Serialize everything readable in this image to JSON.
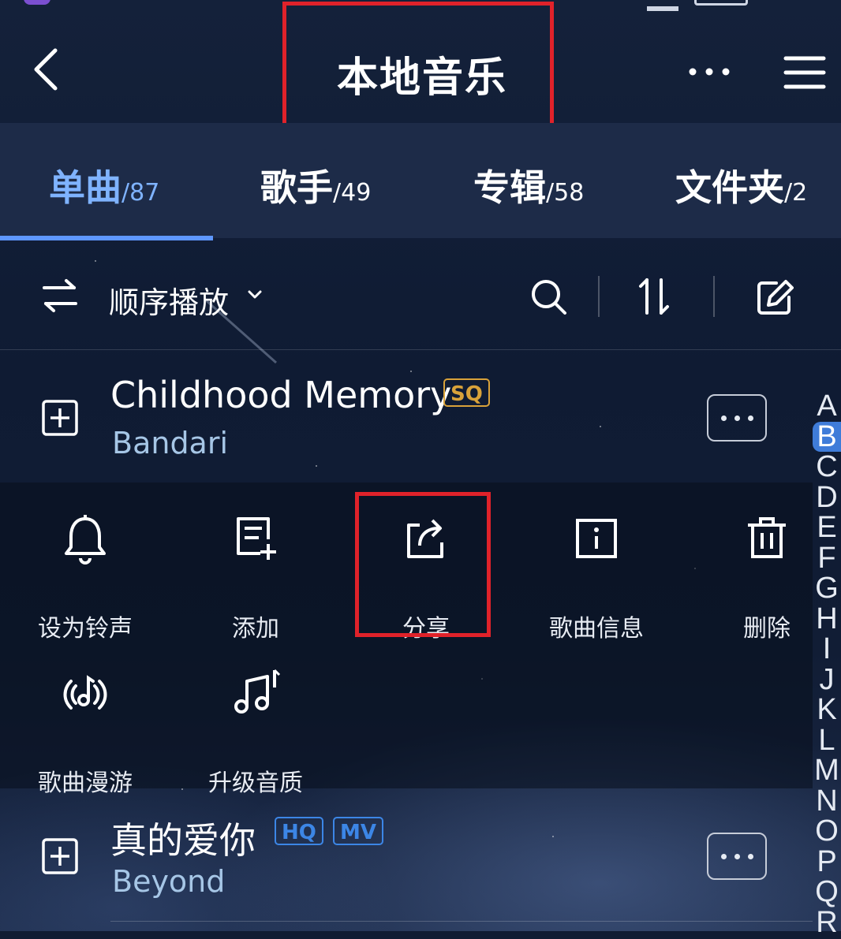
{
  "header": {
    "title": "本地音乐",
    "back_icon": "chevron-left-icon",
    "more_icon": "more-icon",
    "menu_icon": "hamburger-menu-icon"
  },
  "tabs": [
    {
      "label": "单曲",
      "count": "/87",
      "active": true
    },
    {
      "label": "歌手",
      "count": "/49",
      "active": false
    },
    {
      "label": "专辑",
      "count": "/58",
      "active": false
    },
    {
      "label": "文件夹",
      "count": "/2",
      "active": false
    }
  ],
  "toolbar": {
    "play_mode_label": "顺序播放",
    "icons": [
      "shuffle-order-icon",
      "chevron-down-icon",
      "search-icon",
      "sort-icon",
      "edit-icon"
    ]
  },
  "songs": [
    {
      "title": "Childhood Memory",
      "artist": "Bandari",
      "badges": [
        "SQ"
      ]
    },
    {
      "title": "真的爱你",
      "artist": "Beyond",
      "badges": [
        "HQ",
        "MV"
      ]
    }
  ],
  "actions": [
    {
      "label": "设为铃声",
      "icon": "bell-icon"
    },
    {
      "label": "添加",
      "icon": "add-to-list-icon"
    },
    {
      "label": "分享",
      "icon": "share-icon"
    },
    {
      "label": "歌曲信息",
      "icon": "info-icon"
    },
    {
      "label": "删除",
      "icon": "trash-icon"
    },
    {
      "label": "歌曲漫游",
      "icon": "music-roam-icon"
    },
    {
      "label": "升级音质",
      "icon": "music-notes-icon"
    }
  ],
  "index_letters": [
    "A",
    "B",
    "C",
    "D",
    "E",
    "F",
    "G",
    "H",
    "I",
    "J",
    "K",
    "L",
    "M",
    "N",
    "O",
    "P",
    "Q",
    "R"
  ],
  "index_active": "B",
  "colors": {
    "accent_blue": "#5e97ff",
    "highlight_red": "#e0222a",
    "sq_badge": "#d9a23a",
    "hq_badge": "#3c86e6"
  }
}
